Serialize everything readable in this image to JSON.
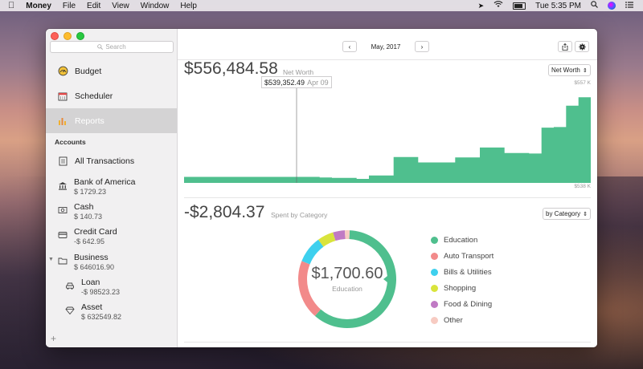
{
  "menubar": {
    "app_name": "Money",
    "menus": [
      "File",
      "Edit",
      "View",
      "Window",
      "Help"
    ],
    "clock": "Tue 5:35 PM"
  },
  "sidebar": {
    "search_placeholder": "Search",
    "nav": [
      {
        "label": "Budget",
        "icon": "budget-icon"
      },
      {
        "label": "Scheduler",
        "icon": "calendar-icon"
      },
      {
        "label": "Reports",
        "icon": "bar-chart-icon"
      }
    ],
    "accounts_header": "Accounts",
    "all_transactions": "All Transactions",
    "accounts": [
      {
        "name": "Bank of America",
        "balance": "$ 1729.23",
        "icon": "bank-icon"
      },
      {
        "name": "Cash",
        "balance": "$ 140.73",
        "icon": "cash-icon"
      },
      {
        "name": "Credit Card",
        "balance": "-$ 642.95",
        "icon": "credit-card-icon"
      },
      {
        "name": "Business",
        "balance": "$ 646016.90",
        "icon": "folder-icon"
      },
      {
        "name": "Loan",
        "balance": "-$ 98523.23",
        "icon": "car-icon"
      },
      {
        "name": "Asset",
        "balance": "$ 632549.82",
        "icon": "diamond-icon"
      }
    ]
  },
  "toolbar": {
    "date": "May, 2017",
    "prev": "‹",
    "next": "›"
  },
  "net_worth": {
    "value": "$556,484.58",
    "label": "Net Worth",
    "dropdown": "Net Worth",
    "tooltip_value": "$539,352.49",
    "tooltip_date": "Apr 09",
    "max_label": "$557 K",
    "min_label": "$538 K"
  },
  "spent": {
    "value": "-$2,804.37",
    "label": "Spent by Category",
    "dropdown": "by Category",
    "center_value": "$1,700.60",
    "center_label": "Education"
  },
  "colors": {
    "accent_green": "#4fbf8e",
    "education": "#4fbf8e",
    "auto_transport": "#f28a8a",
    "bills_utilities": "#3ed0ee",
    "shopping": "#d9e43c",
    "food_dining": "#c07ac4",
    "other": "#f7cbc2"
  },
  "chart_data": [
    {
      "type": "area",
      "title": "Net Worth",
      "ylim": [
        538,
        557
      ],
      "series": [
        {
          "name": "Net Worth",
          "values": [
            539.2,
            539.2,
            539.2,
            539.2,
            539.2,
            539.2,
            539.2,
            539.2,
            539.2,
            539.2,
            539.2,
            539.1,
            539.0,
            539.0,
            538.8,
            539.5,
            539.5,
            543.2,
            543.2,
            542.1,
            542.1,
            542.1,
            543.1,
            543.1,
            545.1,
            545.1,
            544.0,
            544.0,
            543.9,
            549.1,
            549.2,
            553.5,
            555.2,
            555.2
          ]
        }
      ]
    },
    {
      "type": "pie",
      "title": "Spent by Category",
      "categories": [
        "Education",
        "Auto Transport",
        "Bills & Utilities",
        "Shopping",
        "Food & Dining",
        "Other"
      ],
      "values": [
        1700.6,
        550,
        250,
        150,
        110,
        44
      ],
      "colors": [
        "#4fbf8e",
        "#f28a8a",
        "#3ed0ee",
        "#d9e43c",
        "#c07ac4",
        "#f7cbc2"
      ]
    }
  ]
}
